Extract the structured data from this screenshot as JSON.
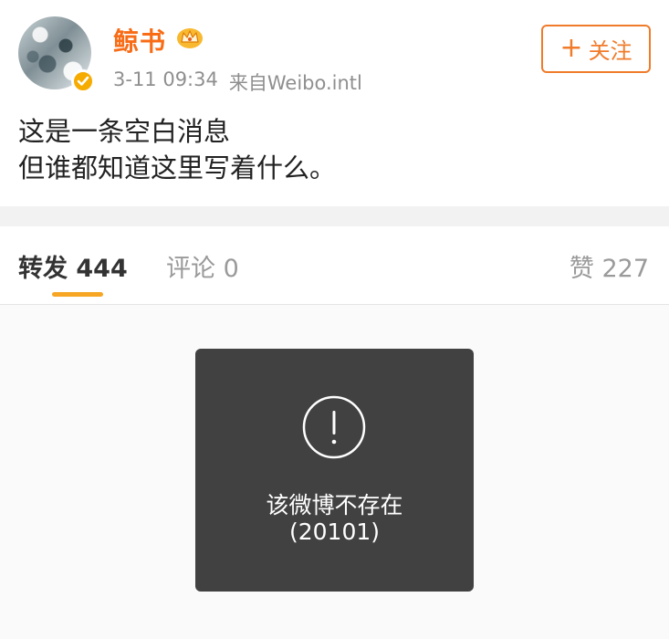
{
  "post": {
    "username": "鲸书",
    "timestamp": "3-11 09:34",
    "source": "来自Weibo.intl",
    "follow_button": {
      "plus": "+",
      "label": "关注"
    },
    "content_line1": "这是一条空白消息",
    "content_line2": "但谁都知道这里写着什么。"
  },
  "tabs": {
    "repost": "转发 444",
    "comment": "评论 0",
    "like": "赞 227"
  },
  "toast": {
    "message": "该微博不存在",
    "code": "(20101)"
  },
  "colors": {
    "username": "#f86c16",
    "follow": "#f07b2a",
    "tab_underline": "#f6a623",
    "toast_bg": "#414141"
  },
  "icons": [
    "verified-badge-icon",
    "crown-icon",
    "warning-icon"
  ]
}
